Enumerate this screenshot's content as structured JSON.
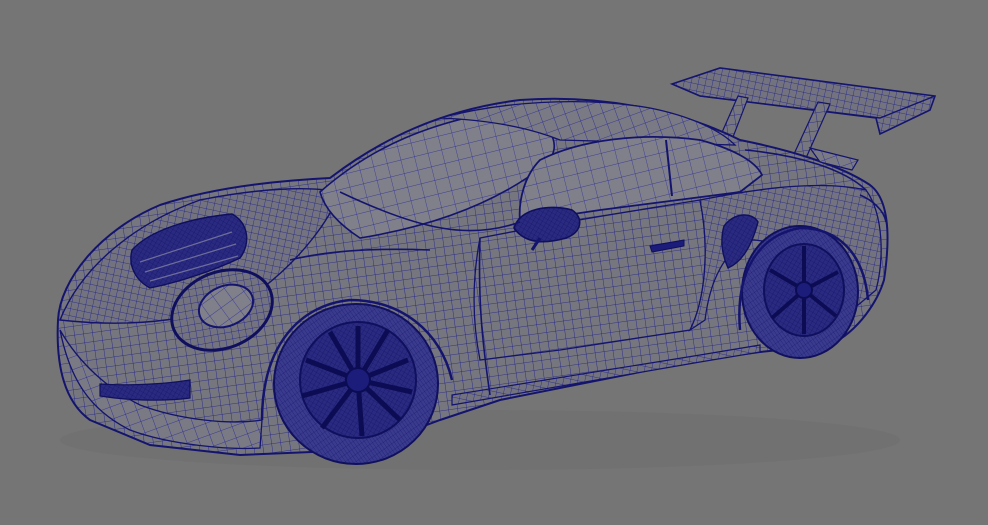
{
  "scene": {
    "subject": "sports-car-wireframe-mesh",
    "background_color": "#757575",
    "wire_color": "#1a1a8c",
    "wire_color_dense": "#14146e",
    "wire_color_light": "#3a3aa6",
    "body_shade": "#6f6f7a"
  }
}
